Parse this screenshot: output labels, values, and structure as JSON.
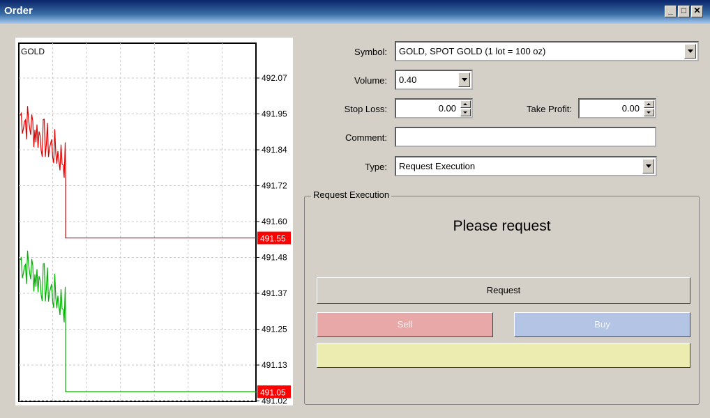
{
  "window": {
    "title": "Order"
  },
  "chart": {
    "symbol_label": "GOLD",
    "price_ticks": [
      "492.07",
      "491.95",
      "491.84",
      "491.72",
      "491.60",
      "491.48",
      "491.37",
      "491.25",
      "491.13",
      "491.02"
    ],
    "ask_marker": "491.55",
    "bid_marker": "491.05",
    "colors": {
      "ask": "#e00000",
      "bid": "#00b000",
      "marker_bg": "#ff0000"
    }
  },
  "form": {
    "symbol_label": "Symbol:",
    "symbol_value": "GOLD, SPOT GOLD (1 lot = 100 oz)",
    "volume_label": "Volume:",
    "volume_value": "0.40",
    "stop_loss_label": "Stop Loss:",
    "stop_loss_value": "0.00",
    "take_profit_label": "Take Profit:",
    "take_profit_value": "0.00",
    "comment_label": "Comment:",
    "comment_value": "",
    "type_label": "Type:",
    "type_value": "Request Execution"
  },
  "execution": {
    "group_title": "Request Execution",
    "message": "Please request",
    "request_label": "Request",
    "sell_label": "Sell",
    "buy_label": "Buy"
  }
}
